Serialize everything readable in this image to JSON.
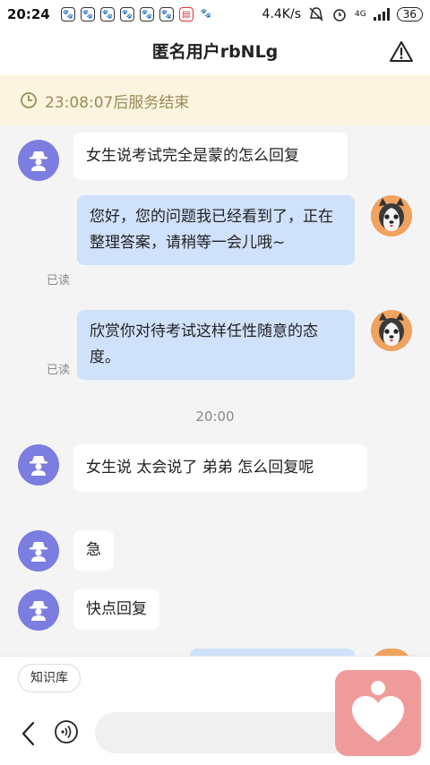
{
  "status_bar": {
    "time": "20:24",
    "network_speed": "4.4K/s",
    "signal": "4G",
    "battery": "36"
  },
  "header": {
    "title": "匿名用户rbNLg"
  },
  "timer": {
    "text": "23:08:07后服务结束"
  },
  "messages": [
    {
      "side": "in",
      "text": "女生说考试完全是蒙的怎么回复"
    },
    {
      "side": "out",
      "text": "您好，您的问题我已经看到了，正在整理答案，请稍等一会儿哦~",
      "read": "已读"
    },
    {
      "side": "out",
      "text": "欣赏你对待考试这样任性随意的态度。",
      "read": "已读"
    },
    {
      "side": "time",
      "text": "20:00"
    },
    {
      "side": "in",
      "text": "女生说  太会说了  弟弟  怎么回复呢"
    },
    {
      "side": "in",
      "text": "急"
    },
    {
      "side": "in",
      "text": "快点回复"
    }
  ],
  "bottom": {
    "knowledge_chip": "知识库"
  },
  "colors": {
    "user_avatar": "#7b7de0",
    "outgoing_bubble": "#cfe1fb",
    "timer_bg": "#fbf5df",
    "logo_bg": "#ef9b9b"
  }
}
